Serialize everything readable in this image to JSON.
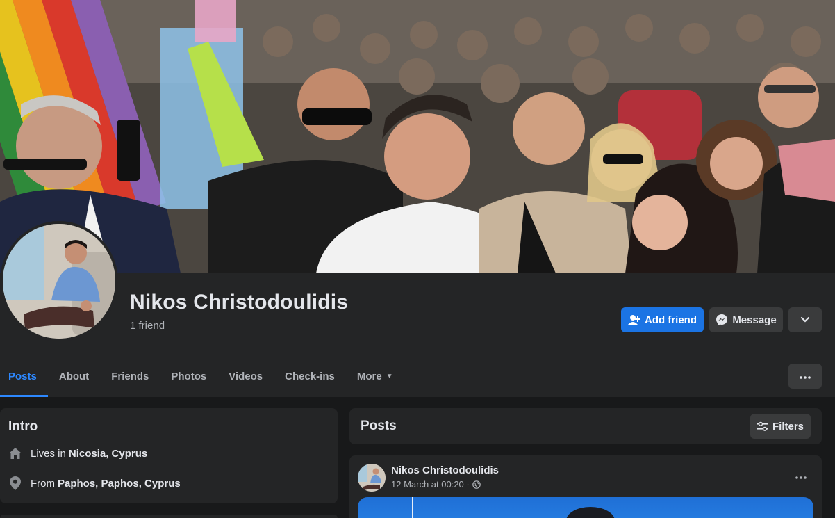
{
  "profile": {
    "name": "Nikos Christodoulidis",
    "friends_count": "1 friend"
  },
  "actions": {
    "add_friend": "Add friend",
    "message": "Message"
  },
  "tabs": [
    {
      "label": "Posts",
      "active": true
    },
    {
      "label": "About"
    },
    {
      "label": "Friends"
    },
    {
      "label": "Photos"
    },
    {
      "label": "Videos"
    },
    {
      "label": "Check-ins"
    },
    {
      "label": "More"
    }
  ],
  "intro": {
    "title": "Intro",
    "lives_prefix": "Lives in",
    "lives_place": "Nicosia, Cyprus",
    "from_prefix": "From",
    "from_place": "Paphos, Paphos, Cyprus"
  },
  "posts": {
    "title": "Posts",
    "filters_label": "Filters",
    "first_post": {
      "author": "Nikos Christodoulidis",
      "time": "12 March at 00:20 ·"
    }
  },
  "colors": {
    "accent": "#1b74e4",
    "active_tab": "#2d88ff",
    "card": "#242526",
    "background": "#18191a"
  },
  "icons": [
    "add-friend-icon",
    "messenger-icon",
    "chevron-down-icon",
    "caret-down-icon",
    "more-dots-icon",
    "home-icon",
    "location-pin-icon",
    "filters-sliders-icon",
    "globe-icon"
  ]
}
